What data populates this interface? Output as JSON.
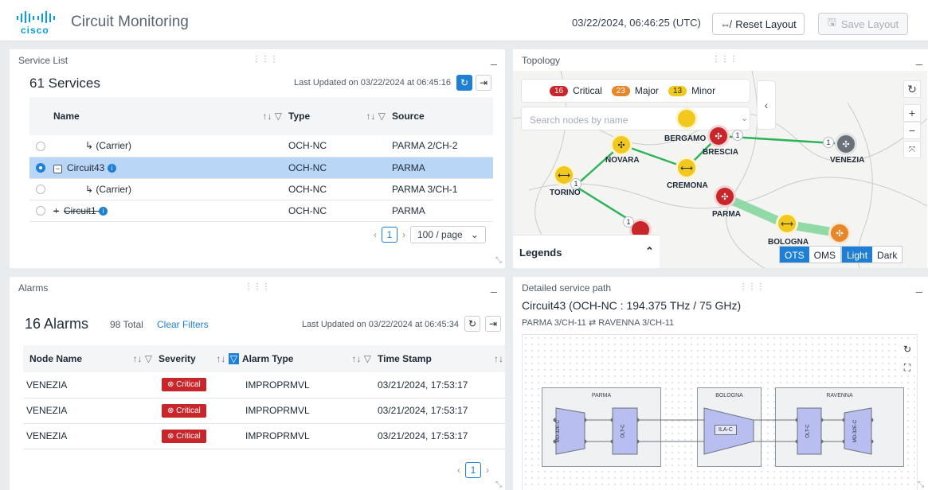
{
  "header": {
    "title": "Circuit Monitoring",
    "logo_text": "cisco",
    "timestamp": "03/22/2024, 06:46:25 (UTC)",
    "reset_label": "Reset Layout",
    "save_label": "Save Layout"
  },
  "service_list": {
    "panel_title": "Service List",
    "count": "61 Services",
    "last_updated": "Last Updated on 03/22/2024 at 06:45:16",
    "columns": [
      "Name",
      "Type",
      "Source"
    ],
    "rows": [
      {
        "name": "↳ (Carrier)",
        "type": "OCH-NC",
        "source": "PARMA 2/CH-2",
        "selected": false
      },
      {
        "name": "Circuit43",
        "type": "OCH-NC",
        "source": "PARMA",
        "selected": true
      },
      {
        "name": "↳ (Carrier)",
        "type": "OCH-NC",
        "source": "PARMA 3/CH-1",
        "selected": false
      },
      {
        "name": "Circuit1",
        "type": "OCH-NC",
        "source": "PARMA",
        "selected": false
      }
    ],
    "page": "1",
    "page_size": "100 / page"
  },
  "topology": {
    "panel_title": "Topology",
    "critical_count": "16",
    "critical_label": "Critical",
    "major_count": "23",
    "major_label": "Major",
    "minor_count": "13",
    "minor_label": "Minor",
    "search_placeholder": "Search nodes by name",
    "legends_label": "Legends",
    "layer_options": [
      "OTS",
      "OMS"
    ],
    "theme_options": [
      "Light",
      "Dark"
    ],
    "nodes": [
      "BERGAMO",
      "BRESCIA",
      "VENEZIA",
      "NOVARA",
      "CREMONA",
      "TORINO",
      "PARMA",
      "BOLOGNA"
    ],
    "badge_values": [
      "1",
      "1",
      "1",
      "1"
    ]
  },
  "alarms": {
    "panel_title": "Alarms",
    "count": "16 Alarms",
    "total": "98 Total",
    "clear_filters": "Clear Filters",
    "last_updated": "Last Updated on 03/22/2024 at 06:45:34",
    "columns": [
      "Node Name",
      "Severity",
      "Alarm Type",
      "Time Stamp"
    ],
    "rows": [
      {
        "node": "VENEZIA",
        "severity": "Critical",
        "type": "IMPROPRMVL",
        "time": "03/21/2024, 17:53:17"
      },
      {
        "node": "VENEZIA",
        "severity": "Critical",
        "type": "IMPROPRMVL",
        "time": "03/21/2024, 17:53:17"
      },
      {
        "node": "VENEZIA",
        "severity": "Critical",
        "type": "IMPROPRMVL",
        "time": "03/21/2024, 17:53:17"
      }
    ],
    "page": "1"
  },
  "service_path": {
    "panel_title": "Detailed service path",
    "title": "Circuit43 (OCH-NC : 194.375 THz / 75 GHz)",
    "subtitle": "PARMA 3/CH-11 ⇄ RAVENNA 3/CH-11",
    "sites": [
      "PARMA",
      "BOLOGNA",
      "RAVENNA"
    ],
    "device_labels": {
      "md_left": "MD-32E-C",
      "olt_left": "OLT-C",
      "ila": "ILA-C",
      "olt_right": "OLT-C",
      "md_right": "MD-32E-C"
    }
  },
  "colors": {
    "accent": "#1e7fd4",
    "critical": "#c8262b",
    "major": "#e8862a",
    "minor": "#f2c81e",
    "link": "#2fb35a"
  }
}
